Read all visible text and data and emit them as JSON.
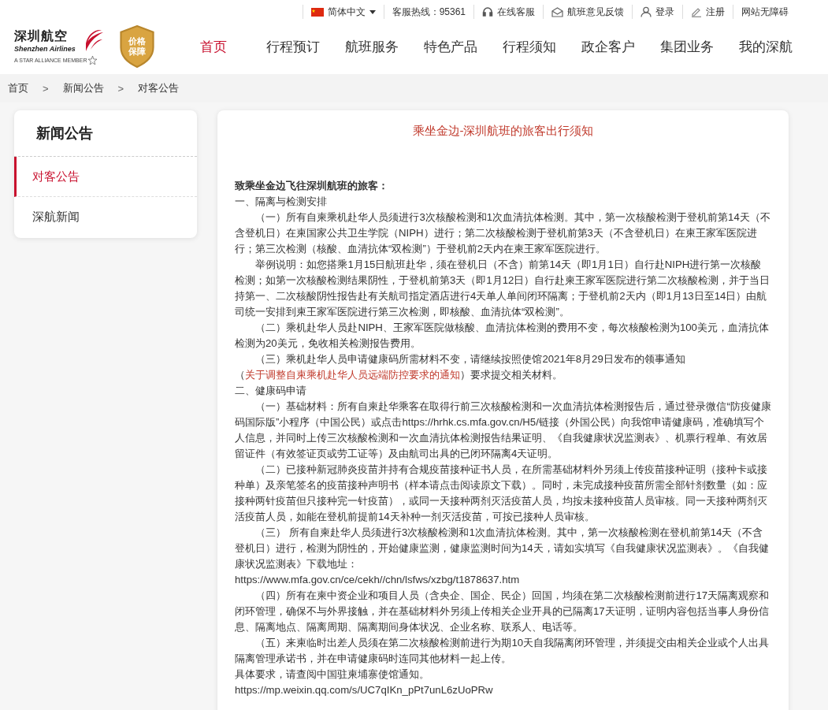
{
  "top_links": [
    {
      "kind": "language",
      "label": "简体中文"
    },
    {
      "kind": "hotline",
      "label": "客服热线：95361"
    },
    {
      "kind": "service",
      "label": "在线客服"
    },
    {
      "kind": "feedback",
      "label": "航班意见反馈"
    },
    {
      "kind": "login",
      "label": "登录"
    },
    {
      "kind": "register",
      "label": "注册"
    },
    {
      "kind": "accessibility",
      "label": "网站无障碍"
    }
  ],
  "logo": {
    "name_cn": "深圳航空",
    "name_en": "Shenzhen Airlines",
    "alliance": "A STAR ALLIANCE MEMBER"
  },
  "badge": [
    "价格",
    "保障"
  ],
  "nav": [
    {
      "label": "首页",
      "selected": true
    },
    {
      "label": "行程预订",
      "selected": false
    },
    {
      "label": "航班服务",
      "selected": false
    },
    {
      "label": "特色产品",
      "selected": false
    },
    {
      "label": "行程须知",
      "selected": false
    },
    {
      "label": "政企客户",
      "selected": false
    },
    {
      "label": "集团业务",
      "selected": false
    },
    {
      "label": "我的深航",
      "selected": false
    }
  ],
  "breadcrumb": {
    "separator": ">",
    "items": [
      "首页",
      "新闻公告",
      "对客公告"
    ]
  },
  "sidebar": {
    "title": "新闻公告",
    "items": [
      {
        "label": "对客公告",
        "selected": true
      },
      {
        "label": "深航新闻",
        "selected": false
      }
    ]
  },
  "article": {
    "title": "乘坐金边-深圳航班的旅客出行须知",
    "paragraphs": [
      {
        "kind": "greeting",
        "text": "致乘坐金边飞往深圳航班的旅客："
      },
      {
        "kind": "heading",
        "text": "一、隔离与检测安排"
      },
      {
        "kind": "indent",
        "text": "（一）所有自柬乘机赴华人员须进行3次核酸检测和1次血清抗体检测。其中，第一次核酸检测于登机前第14天（不含登机日）在柬国家公共卫生学院（NIPH）进行；第二次核酸检测于登机前第3天（不含登机日）在柬王家军医院进行；第三次检测（核酸、血清抗体“双检测”）于登机前2天内在柬王家军医院进行。"
      },
      {
        "kind": "indent",
        "text": "举例说明：如您搭乘1月15日航班赴华，须在登机日（不含）前第14天（即1月1日）自行赴NIPH进行第一次核酸检测；如第一次核酸检测结果阴性，于登机前第3天（即1月12日）自行赴柬王家军医院进行第二次核酸检测，并于当日持第一、二次核酸阴性报告赴有关航司指定酒店进行4天单人单间闭环隔离；于登机前2天内（即1月13日至14日）由航司统一安排到柬王家军医院进行第三次检测，即核酸、血清抗体“双检测”。"
      },
      {
        "kind": "indent",
        "text": "（二）乘机赴华人员赴NIPH、王家军医院做核酸、血清抗体检测的费用不变，每次核酸检测为100美元，血清抗体检测为20美元，免收相关检测报告费用。"
      },
      {
        "kind": "indent",
        "text": "（三）乘机赴华人员申请健康码所需材料不变，请继续按照使馆2021年8月29日发布的领事通知（",
        "link": "关于调整自柬乘机赴华人员远端防控要求的通知",
        "after": "）要求提交相关材料。"
      },
      {
        "kind": "heading",
        "text": "二、健康码申请"
      },
      {
        "kind": "indent",
        "text": "（一）基础材料：所有自柬赴华乘客在取得行前三次核酸检测和一次血清抗体检测报告后，通过登录微信“防疫健康码国际版”小程序（中国公民）或点击https://hrhk.cs.mfa.gov.cn/H5/链接（外国公民）向我馆申请健康码，准确填写个人信息，并同时上传三次核酸检测和一次血清抗体检测报告结果证明、《自我健康状况监测表》、机票行程单、有效居留证件（有效签证页或劳工证等）及由航司出具的已闭环隔离4天证明。"
      },
      {
        "kind": "indent",
        "text": "（二）已接种新冠肺炎疫苗并持有合规疫苗接种证书人员，在所需基础材料外另须上传疫苗接种证明（接种卡或接种单）及亲笔签名的疫苗接种声明书（样本请点击阅读原文下载）。同时，未完成接种疫苗所需全部针剂数量（如：应接种两针疫苗但只接种完一针疫苗），或同一天接种两剂灭活疫苗人员，均按未接种疫苗人员审核。同一天接种两剂灭活疫苗人员，如能在登机前提前14天补种一剂灭活疫苗，可按已接种人员审核。"
      },
      {
        "kind": "indent",
        "text": "（三） 所有自柬赴华人员须进行3次核酸检测和1次血清抗体检测。其中，第一次核酸检测在登机前第14天（不含登机日）进行，检测为阴性的，开始健康监测，健康监测时间为14天，请如实填写《自我健康状况监测表》。《自我健康状况监测表》下载地址："
      },
      {
        "kind": "plain",
        "text": "https://www.mfa.gov.cn/ce/cekh//chn/lsfws/xzbg/t1878637.htm"
      },
      {
        "kind": "indent",
        "text": "（四）所有在柬中资企业和项目人员（含央企、国企、民企）回国，均须在第二次核酸检测前进行17天隔离观察和闭环管理，确保不与外界接触，并在基础材料外另须上传相关企业开具的已隔离17天证明，证明内容包括当事人身份信息、隔离地点、隔离周期、隔离期间身体状况、企业名称、联系人、电话等。"
      },
      {
        "kind": "indent",
        "text": "（五）来柬临时出差人员须在第二次核酸检测前进行为期10天自我隔离闭环管理，并须提交由相关企业或个人出具隔离管理承诺书，并在申请健康码时连同其他材料一起上传。"
      },
      {
        "kind": "plain",
        "text": "具体要求，请查阅中国驻柬埔寨使馆通知。"
      },
      {
        "kind": "plain",
        "text": "https://mp.weixin.qq.com/s/UC7qIKn_pPt7unL6zUoPRw"
      }
    ]
  }
}
